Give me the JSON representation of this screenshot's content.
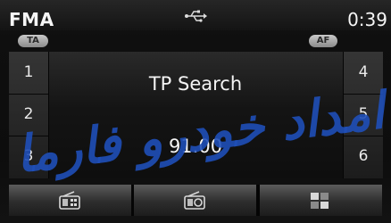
{
  "status_bar": {
    "band": "FMA",
    "clock": "0:39",
    "connection_icon": "usb-icon"
  },
  "toggles": {
    "ta_label": "TA",
    "af_label": "AF"
  },
  "presets": {
    "left": [
      "1",
      "2",
      "3"
    ],
    "right": [
      "4",
      "5",
      "6"
    ]
  },
  "main": {
    "status_text": "TP Search",
    "frequency": "91.00"
  },
  "bottom_bar": {
    "buttons": [
      {
        "icon": "radio-presets-icon"
      },
      {
        "icon": "radio-search-icon"
      },
      {
        "icon": "menu-grid-icon"
      }
    ]
  },
  "watermark": {
    "text": "امداد خودرو فارما",
    "color": "#1f4fb8"
  }
}
